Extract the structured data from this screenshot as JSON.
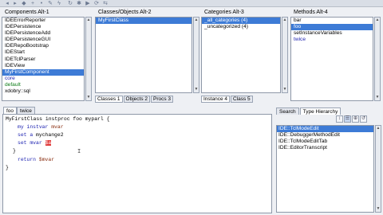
{
  "toolbar": {
    "icons": [
      "back-icon",
      "forward-icon",
      "class-icon",
      "add-icon",
      "pin-icon",
      "wrench-icon",
      "bolt-icon",
      "refresh-icon",
      "bug-icon",
      "run-icon",
      "cycle-icon",
      "sync-icon"
    ]
  },
  "components": {
    "title": "Components Alt-1",
    "items": [
      {
        "label": "IDEErrorReporter",
        "selected": false,
        "style": ""
      },
      {
        "label": "IDEPersistence",
        "selected": false,
        "style": ""
      },
      {
        "label": "IDEPersistenceAdd",
        "selected": false,
        "style": ""
      },
      {
        "label": "IDEPersistenceGUI",
        "selected": false,
        "style": ""
      },
      {
        "label": "IDERepoBootstrap",
        "selected": false,
        "style": ""
      },
      {
        "label": "IDEStart",
        "selected": false,
        "style": ""
      },
      {
        "label": "IDETclParser",
        "selected": false,
        "style": ""
      },
      {
        "label": "IDEView",
        "selected": false,
        "style": ""
      },
      {
        "label": "MyFirstComponent",
        "selected": true,
        "style": ""
      },
      {
        "label": "core",
        "selected": false,
        "style": "blue"
      },
      {
        "label": "default",
        "selected": false,
        "style": "green"
      },
      {
        "label": "xdobry::sql",
        "selected": false,
        "style": ""
      }
    ]
  },
  "classes": {
    "title": "Classes/Objects Alt-2",
    "items": [
      {
        "label": "MyFirstClass",
        "selected": true
      }
    ],
    "tabs": [
      {
        "label": "Classes 1",
        "active": true
      },
      {
        "label": "Objects 2",
        "active": false
      },
      {
        "label": "Procs 3",
        "active": false
      }
    ]
  },
  "categories": {
    "title": "Categories Alt-3",
    "items": [
      {
        "label": "_all_categories (4)",
        "selected": true
      },
      {
        "label": "_uncategorized (4)",
        "selected": false
      }
    ],
    "tabs": [
      {
        "label": "Instance 4",
        "active": true
      },
      {
        "label": "Class 5",
        "active": false
      }
    ]
  },
  "methods": {
    "title": "Methods Alt-4",
    "items": [
      {
        "label": "bar",
        "selected": false,
        "style": ""
      },
      {
        "label": "foo",
        "selected": true,
        "style": ""
      },
      {
        "label": "setInstanceVariables",
        "selected": false,
        "style": ""
      },
      {
        "label": "twice",
        "selected": false,
        "style": "blue"
      }
    ]
  },
  "editor": {
    "tabs": [
      {
        "label": "foo",
        "active": true
      },
      {
        "label": "twice",
        "active": false
      }
    ],
    "lines": {
      "l1": "MyFirstClass instproc foo myparl {",
      "l2_kw": "my instvar",
      "l2_var": "mvar",
      "l3_kw": "set a",
      "l3_rest": "mychange2",
      "l4_kw": "set mvar",
      "l4_sel": "$a",
      "l5": "}",
      "l6_kw": "return",
      "l6_var": "$mvar",
      "l7": "}"
    }
  },
  "right_pane": {
    "tabs": [
      {
        "label": "Search",
        "active": false
      },
      {
        "label": "Type Hierarchy",
        "active": true
      }
    ],
    "tool_icons": [
      "hierarchy-toggle-icon",
      "hierarchy-filter-icon",
      "add-filter-icon",
      "refresh-hierarchy-icon"
    ],
    "hierarchy": [
      {
        "label": "IDE::TclModeEdit",
        "selected": true
      },
      {
        "label": "IDE::DebuggerMethodEdit",
        "selected": false
      },
      {
        "label": "IDE::TclModeEditTab",
        "selected": false
      },
      {
        "label": "IDE::EditorTranscript",
        "selected": false
      }
    ]
  }
}
